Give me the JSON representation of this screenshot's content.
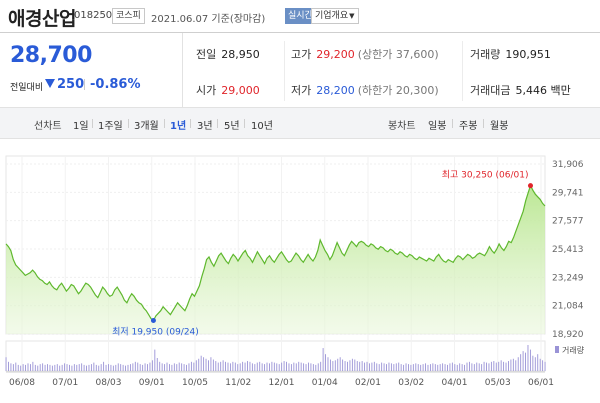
{
  "header": {
    "stock_name": "애경산업",
    "stock_code": "018250",
    "market": "코스피",
    "date_text": "2021.06.07 기준(장마감)",
    "realtime": "실시간",
    "company_info": "기업개요",
    "company_info_caret": "▼"
  },
  "summary": {
    "current_price": "28,700",
    "change_label": "전일대비",
    "change_value": "250",
    "change_pct": "-0.86%",
    "prev_close_label": "전일",
    "prev_close": "28,950",
    "high_label": "고가",
    "high": "29,200",
    "upper_limit": "(상한가 37,600)",
    "volume_label": "거래량",
    "volume": "190,951",
    "open_label": "시가",
    "open": "29,000",
    "low_label": "저가",
    "low": "28,200",
    "lower_limit": "(하한가 20,300)",
    "amount_label": "거래대금",
    "amount": "5,446",
    "amount_unit": "백만",
    "colors": {
      "up": "#e0252b",
      "down": "#2a5bd7"
    }
  },
  "toolbar": {
    "line_label": "선차트",
    "line_periods": [
      "1일",
      "1주일",
      "3개월",
      "1년",
      "3년",
      "5년",
      "10년"
    ],
    "active_period": "1년",
    "candle_label": "봉차트",
    "candle_periods": [
      "일봉",
      "주봉",
      "월봉"
    ]
  },
  "chart_data": {
    "type": "area",
    "title": "",
    "xlabel": "",
    "ylabel": "",
    "x_ticks": [
      "06/08",
      "07/01",
      "08/03",
      "09/01",
      "10/05",
      "11/02",
      "12/01",
      "01/04",
      "02/01",
      "03/02",
      "04/01",
      "05/03",
      "06/01"
    ],
    "y_ticks": [
      31906,
      29741,
      27577,
      25413,
      23249,
      21084,
      18920
    ],
    "y_tick_labels": [
      "31,906",
      "29,741",
      "27,577",
      "25,413",
      "23,249",
      "21,084",
      "18,920"
    ],
    "ylim": [
      18920,
      31906
    ],
    "grid": true,
    "series": [
      {
        "values": [
          25800,
          25600,
          25300,
          24600,
          24200,
          24000,
          23800,
          23600,
          23400,
          23500,
          23600,
          23800,
          23600,
          23300,
          23100,
          23000,
          22800,
          22700,
          22900,
          22600,
          22400,
          22300,
          22600,
          22800,
          22500,
          22200,
          22400,
          22700,
          22600,
          22300,
          22000,
          22200,
          22500,
          22800,
          22700,
          22500,
          22200,
          21900,
          21700,
          22100,
          22500,
          22300,
          22000,
          21800,
          21900,
          22300,
          22500,
          22200,
          21900,
          21500,
          21300,
          21700,
          22000,
          21800,
          21500,
          21300,
          21200,
          20900,
          20700,
          20400,
          20100,
          19950,
          20300,
          20500,
          20700,
          21000,
          20800,
          20600,
          20400,
          20700,
          21000,
          21300,
          21100,
          20900,
          20700,
          21100,
          21600,
          22000,
          21800,
          22200,
          22600,
          23300,
          23900,
          24600,
          24800,
          24400,
          24100,
          24500,
          24900,
          25100,
          24800,
          24500,
          24300,
          24700,
          25000,
          24800,
          24500,
          24800,
          25100,
          25300,
          24900,
          24700,
          24400,
          24800,
          25200,
          24900,
          24600,
          24300,
          24700,
          24900,
          24600,
          24400,
          24700,
          25000,
          25200,
          24900,
          24600,
          24400,
          24500,
          24800,
          25100,
          24900,
          24600,
          24400,
          24700,
          25000,
          24700,
          24500,
          24800,
          25300,
          26100,
          25700,
          25300,
          25000,
          24600,
          24900,
          25400,
          25900,
          25500,
          25100,
          24900,
          25300,
          25700,
          26000,
          25800,
          25600,
          25900,
          26000,
          25900,
          25700,
          25600,
          25800,
          25700,
          25500,
          25400,
          25600,
          25500,
          25300,
          25200,
          25400,
          25300,
          25100,
          25000,
          25200,
          25100,
          24900,
          24800,
          25000,
          24900,
          24700,
          24600,
          24800,
          24700,
          24600,
          24500,
          24700,
          24600,
          24500,
          24800,
          25000,
          24700,
          24500,
          24400,
          24600,
          24500,
          24400,
          24700,
          24900,
          24800,
          24600,
          24800,
          25000,
          24900,
          24700,
          24800,
          25000,
          25100,
          25000,
          24900,
          25200,
          25600,
          25300,
          25100,
          25400,
          25800,
          25500,
          25300,
          25600,
          26000,
          25900,
          26300,
          26800,
          27300,
          27800,
          28300,
          29100,
          29700,
          30250,
          29900,
          29600,
          29400,
          29200,
          28900,
          28700
        ]
      }
    ],
    "annotations": [
      {
        "label": "최고",
        "value": "30,250",
        "date": "(06/01)"
      },
      {
        "label": "최저",
        "value": "19,950",
        "date": "(09/24)"
      }
    ],
    "volume_label": "거래량",
    "volume": [
      18,
      12,
      10,
      9,
      11,
      8,
      7,
      9,
      8,
      10,
      9,
      12,
      8,
      7,
      9,
      10,
      8,
      9,
      8,
      7,
      8,
      9,
      7,
      8,
      10,
      9,
      8,
      7,
      9,
      8,
      9,
      10,
      8,
      7,
      8,
      9,
      11,
      8,
      7,
      9,
      12,
      8,
      9,
      8,
      7,
      8,
      10,
      9,
      8,
      7,
      8,
      9,
      10,
      12,
      11,
      9,
      8,
      10,
      9,
      11,
      14,
      28,
      17,
      12,
      10,
      9,
      11,
      9,
      8,
      10,
      9,
      11,
      10,
      9,
      8,
      10,
      12,
      11,
      14,
      16,
      20,
      18,
      16,
      14,
      18,
      15,
      13,
      11,
      12,
      14,
      12,
      11,
      10,
      12,
      11,
      9,
      10,
      12,
      11,
      13,
      12,
      10,
      9,
      11,
      12,
      10,
      9,
      11,
      10,
      12,
      11,
      10,
      9,
      11,
      13,
      12,
      10,
      9,
      11,
      10,
      12,
      11,
      10,
      9,
      11,
      10,
      9,
      8,
      10,
      12,
      30,
      22,
      18,
      15,
      13,
      14,
      16,
      18,
      15,
      13,
      12,
      14,
      16,
      15,
      13,
      12,
      13,
      11,
      12,
      10,
      11,
      12,
      10,
      9,
      11,
      10,
      9,
      11,
      10,
      9,
      10,
      11,
      9,
      8,
      10,
      9,
      8,
      9,
      10,
      9,
      8,
      9,
      10,
      8,
      9,
      10,
      9,
      8,
      9,
      10,
      9,
      8,
      10,
      11,
      9,
      8,
      10,
      9,
      8,
      11,
      12,
      10,
      9,
      11,
      10,
      9,
      12,
      11,
      10,
      12,
      13,
      11,
      12,
      14,
      12,
      11,
      13,
      15,
      16,
      14,
      18,
      22,
      26,
      24,
      34,
      28,
      20,
      18,
      22,
      16,
      14,
      12
    ]
  }
}
